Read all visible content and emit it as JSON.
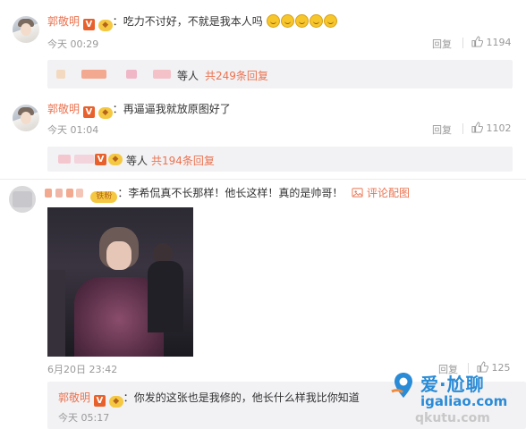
{
  "comments": [
    {
      "author": "郭敬明",
      "text": "吃力不讨好，不就是我本人吗",
      "emoji_count": 5,
      "time": "今天 00:29",
      "reply_label": "回复",
      "likes": "1194",
      "thread": {
        "label": "等人",
        "count_text": "共249条回复"
      }
    },
    {
      "author": "郭敬明",
      "text": "再逼逼我就放原图好了",
      "time": "今天 01:04",
      "reply_label": "回复",
      "likes": "1102",
      "thread": {
        "label": "等人",
        "count_text": "共194条回复"
      }
    },
    {
      "author_hidden": true,
      "badge": "铁粉",
      "text": "李希侃真不长那样！他长这样！真的是帅哥！",
      "pic_link": "评论配图",
      "time": "6月20日 23:42",
      "reply_label": "回复",
      "likes": "125",
      "reply": {
        "author": "郭敬明",
        "text": "你发的这张也是我修的，他长什么样我比你知道",
        "time": "今天 05:17"
      }
    }
  ],
  "watermark": {
    "line1": "爱·尬聊",
    "line2": "igaliao.com",
    "line3": "qkutu.com"
  },
  "colors": {
    "accent": "#eb7350",
    "meta": "#999999",
    "thread_bg": "#f2f2f5"
  }
}
